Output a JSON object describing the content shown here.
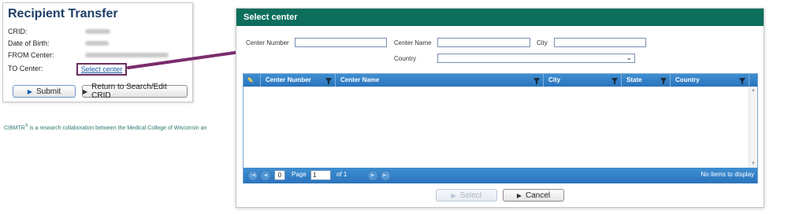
{
  "recipient_transfer": {
    "title": "Recipient Transfer",
    "fields": [
      {
        "label": "CRID:"
      },
      {
        "label": "Date of Birth:"
      },
      {
        "label": "FROM Center:"
      },
      {
        "label": "TO Center:"
      }
    ],
    "select_center_link": "Select center",
    "submit_label": "Submit",
    "return_label": "Return to Search/Edit CRID"
  },
  "footer": {
    "text_before": "CIBMTR",
    "reg_mark": "®",
    "text_after": " is a research collaboration between the Medical College of Wisconsin an"
  },
  "dialog": {
    "title": "Select center",
    "filters": {
      "center_number_label": "Center Number",
      "center_name_label": "Center Name",
      "city_label": "City",
      "country_label": "Country",
      "center_number_value": "",
      "center_name_value": "",
      "city_value": "",
      "country_value": ""
    },
    "grid": {
      "columns": [
        {
          "label": "Center Number"
        },
        {
          "label": "Center Name"
        },
        {
          "label": "City"
        },
        {
          "label": "State"
        },
        {
          "label": "Country"
        }
      ],
      "rows": [],
      "pager": {
        "current_index": "0",
        "page_label": "Page",
        "page_value": "1",
        "of_label": "of 1",
        "status": "No items to display"
      }
    },
    "select_label": "Select",
    "cancel_label": "Cancel"
  },
  "colors": {
    "title_navy": "#1f3e68",
    "dialog_header_green": "#0d6e5c",
    "grid_blue": "#2b74bd",
    "arrow_purple": "#7a2c6c",
    "footer_teal": "#26756e"
  }
}
